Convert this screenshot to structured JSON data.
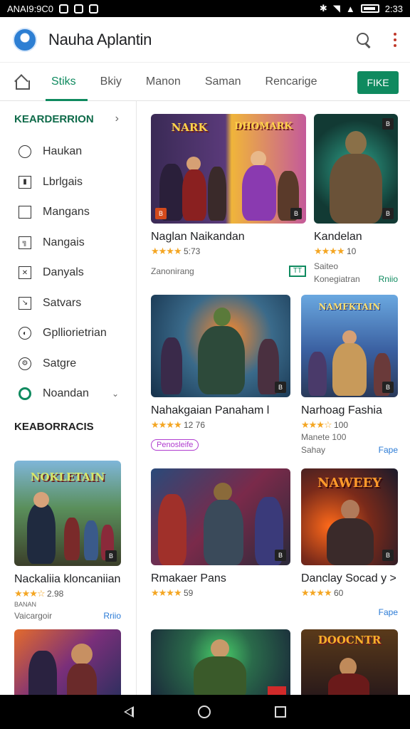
{
  "status_bar": {
    "left_text": "ANAI9:9C0",
    "time": "2:33"
  },
  "app": {
    "title": "Nauha Aplantin"
  },
  "tabs": [
    {
      "label": "Stiks",
      "active": true
    },
    {
      "label": "Bkiy"
    },
    {
      "label": "Manon"
    },
    {
      "label": "Saman"
    },
    {
      "label": "Rencarige"
    }
  ],
  "tab_button": "FIKE",
  "sidebar": {
    "heading": "KEARDERRION",
    "items": [
      {
        "label": "Haukan",
        "icon": "circle-icon"
      },
      {
        "label": "Lbrlgais",
        "icon": "book-icon"
      },
      {
        "label": "Mangans",
        "icon": "bookmark-icon"
      },
      {
        "label": "Nangais",
        "icon": "document-icon"
      },
      {
        "label": "Danyals",
        "icon": "close-box-icon"
      },
      {
        "label": "Satvars",
        "icon": "arrow-box-icon"
      },
      {
        "label": "Gplliorietrian",
        "icon": "compass-icon"
      },
      {
        "label": "Satgre",
        "icon": "gear-icon"
      },
      {
        "label": "Noandan",
        "icon": "green-ring-icon"
      }
    ],
    "section2": "KEABORRACIS",
    "card": {
      "title": "Nackaliia kloncaniianc",
      "rating": "2.98",
      "sub": "Vaicargoir",
      "tag": "Rriio",
      "extra": "BANAN"
    }
  },
  "cards": [
    {
      "title": "Naglan Naikandan",
      "rating": "5:73",
      "meta": "Zanonirang",
      "badge": "B"
    },
    {
      "title": "Kandelan",
      "rating": "10",
      "meta": "Konegiatran",
      "tag": "Rniio",
      "badge": "B",
      "sub": "Saiteo"
    },
    {
      "title": "Nahakgaian Panaham l",
      "rating": "12 76",
      "pill": "Penosleife",
      "badge": "B"
    },
    {
      "title": "Narhoag Fashia",
      "rating": "100",
      "meta": "Sahay",
      "tag": "Fape",
      "sub": "Manete 100",
      "badge": "B"
    },
    {
      "title": "Rmakaer Pans",
      "rating": "59",
      "badge": "B"
    },
    {
      "title": "Danclay Socad y >",
      "rating": "60",
      "tag": "Fape",
      "badge": "B"
    }
  ],
  "logo_texts": [
    "NARK",
    "DHOMARK",
    "NAMFKTAIN",
    "NAWEEY",
    "NOKLETAIN",
    "DOOCNTR"
  ],
  "accent": "#0f8a5f"
}
